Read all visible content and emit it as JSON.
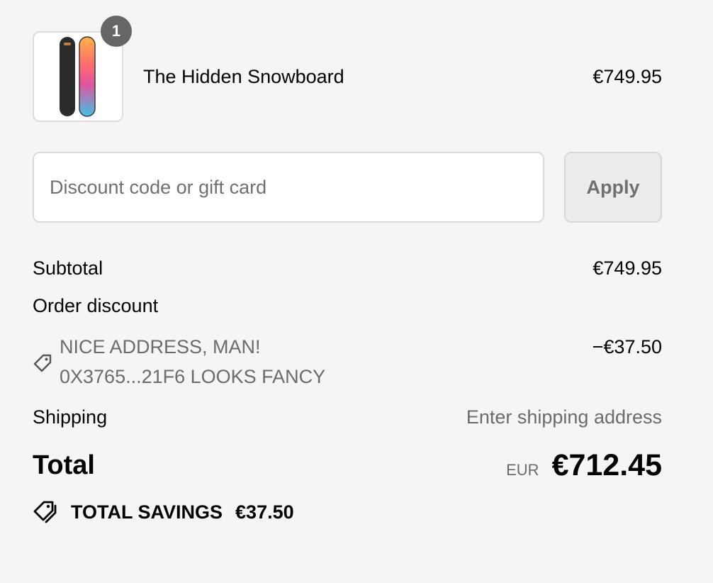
{
  "product": {
    "name": "The Hidden Snowboard",
    "price": "€749.95",
    "quantity": "1",
    "image_icon": "snowboard-image"
  },
  "discount": {
    "placeholder": "Discount code or gift card",
    "value": "",
    "apply_label": "Apply"
  },
  "summary": {
    "subtotal_label": "Subtotal",
    "subtotal_value": "€749.95",
    "order_discount_label": "Order discount",
    "discount_code_line1": "NICE ADDRESS, MAN!",
    "discount_code_line2": "0X3765...21F6 LOOKS FANCY",
    "discount_amount": "−€37.50",
    "discount_icon": "tag-icon",
    "shipping_label": "Shipping",
    "shipping_value": "Enter shipping address",
    "total_label": "Total",
    "currency": "EUR",
    "total_value": "€712.45",
    "savings_label": "TOTAL SAVINGS",
    "savings_value": "€37.50",
    "savings_icon": "tags-icon"
  },
  "colors": {
    "background": "#f5f5f5",
    "muted_text": "#6b6b6b",
    "badge": "#666666"
  }
}
